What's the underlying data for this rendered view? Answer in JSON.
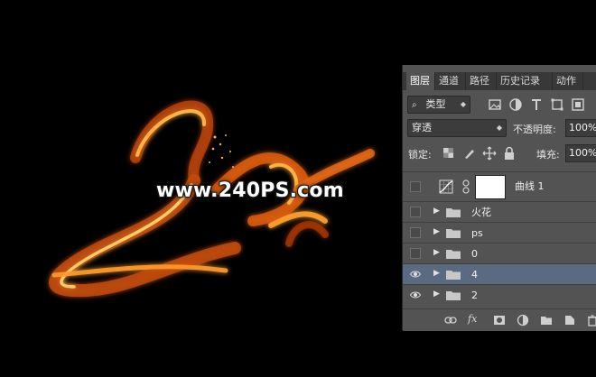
{
  "canvas": {
    "watermark_text": "www.240PS.com"
  },
  "layers_panel": {
    "tabs": [
      "图层",
      "通道",
      "路径",
      "历史记录",
      "动作"
    ],
    "active_tab": 0,
    "filter": {
      "label": "类型",
      "icon": "search-icon"
    },
    "filter_icons": [
      "image-filter-icon",
      "adjustment-filter-icon",
      "type-filter-icon",
      "shape-filter-icon",
      "smart-object-filter-icon"
    ],
    "blend_mode": "穿透",
    "opacity_label": "不透明度:",
    "opacity_value": "100%",
    "lock_label": "锁定:",
    "lock_icons": [
      "lock-transparent-icon",
      "lock-paint-icon",
      "lock-move-icon",
      "lock-all-icon"
    ],
    "fill_label": "填充:",
    "fill_value": "100%",
    "layers": [
      {
        "name": "曲线 1",
        "type": "adjustment",
        "visible": false,
        "selected": false
      },
      {
        "name": "火花",
        "type": "group",
        "visible": false,
        "selected": false
      },
      {
        "name": "ps",
        "type": "group",
        "visible": false,
        "selected": false
      },
      {
        "name": "0",
        "type": "group",
        "visible": false,
        "selected": false
      },
      {
        "name": "4",
        "type": "group",
        "visible": true,
        "selected": true
      },
      {
        "name": "2",
        "type": "group",
        "visible": true,
        "selected": false
      }
    ],
    "bottom_icons": [
      "link-icon",
      "fx-icon",
      "mask-icon",
      "adjustment-icon",
      "folder-icon",
      "new-layer-icon",
      "trash-icon"
    ],
    "fx_label": "fx"
  },
  "colors": {
    "panel_bg": "#535353",
    "selected_row": "#5a6a80",
    "fire_orange": "#ff8a1e"
  }
}
